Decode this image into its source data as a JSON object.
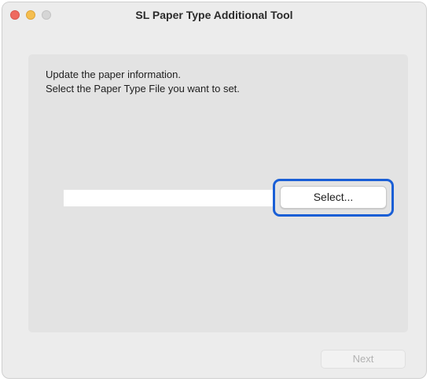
{
  "window": {
    "title": "SL Paper Type Additional Tool"
  },
  "instructions": {
    "line1": "Update the paper information.",
    "line2": "Select the Paper Type File you want to set."
  },
  "file_path": {
    "value": "",
    "placeholder": ""
  },
  "buttons": {
    "select_label": "Select...",
    "next_label": "Next"
  },
  "colors": {
    "highlight": "#1a5fd6",
    "close": "#ee6a5f",
    "minimize": "#f5be4f",
    "zoom_disabled": "#d5d5d5"
  }
}
